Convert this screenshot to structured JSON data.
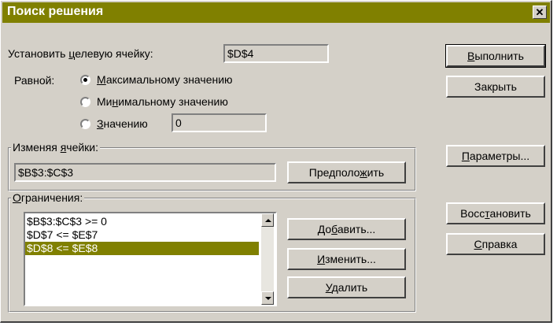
{
  "window": {
    "title": "Поиск решения",
    "close_glyph": "✕"
  },
  "target": {
    "label_pre": "Установить ",
    "label_accel": "ц",
    "label_post": "елевую ячейку:",
    "value": "$D$4"
  },
  "equal_to": {
    "label": "Равной:",
    "options": [
      {
        "pre": "",
        "accel": "М",
        "post": "аксимальному значению",
        "selected": true
      },
      {
        "pre": "Ми",
        "accel": "н",
        "post": "имальному значению",
        "selected": false
      },
      {
        "pre": "",
        "accel": "З",
        "post": "начению",
        "selected": false
      }
    ],
    "value": "0"
  },
  "changing": {
    "title_pre": "Изменяя ",
    "title_accel": "я",
    "title_post": "чейки:",
    "value": "$B$3:$C$3",
    "guess_pre": "Предполо",
    "guess_accel": "ж",
    "guess_post": "ить"
  },
  "constraints": {
    "title_pre": "",
    "title_accel": "О",
    "title_post": "граничения:",
    "items": [
      "$B$3:$C$3 >= 0",
      "$D$7 <= $E$7",
      "$D$8 <= $E$8"
    ],
    "selected_index": 2,
    "add_pre": "До",
    "add_accel": "б",
    "add_post": "авить...",
    "change_pre": "",
    "change_accel": "И",
    "change_post": "зменить...",
    "delete_pre": "",
    "delete_accel": "У",
    "delete_post": "далить"
  },
  "buttons": {
    "solve": {
      "pre": "",
      "accel": "В",
      "post": "ыполнить"
    },
    "close": {
      "label": "Закрыть"
    },
    "options": {
      "pre": "",
      "accel": "П",
      "post": "араметры..."
    },
    "reset": {
      "pre": "Восс",
      "accel": "т",
      "post": "ановить"
    },
    "help": {
      "pre": "",
      "accel": "С",
      "post": "правка"
    }
  },
  "colors": {
    "title_bar": "#808000",
    "selection": "#808000",
    "face": "#d4d0c8"
  }
}
